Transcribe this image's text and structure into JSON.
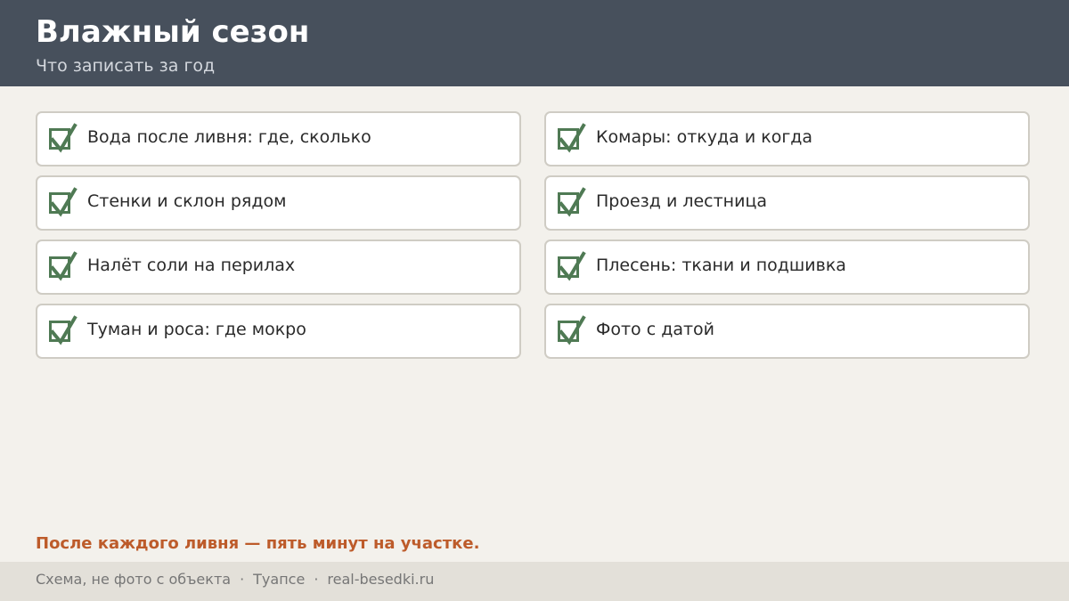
{
  "header": {
    "title": "Влажный сезон",
    "subtitle": "Что записать за год",
    "background_color": "#47505c"
  },
  "checklist": {
    "check_color": "#4f7a54",
    "items": [
      {
        "label": "Вода после ливня: где, сколько",
        "checked": true
      },
      {
        "label": "Комары: откуда и когда",
        "checked": true
      },
      {
        "label": "Стенки и склон рядом",
        "checked": true
      },
      {
        "label": "Проезд и лестница",
        "checked": true
      },
      {
        "label": "Налёт соли на перилах",
        "checked": true
      },
      {
        "label": "Плесень: ткани и подшивка",
        "checked": true
      },
      {
        "label": "Туман и роса: где мокро",
        "checked": true
      },
      {
        "label": "Фото с датой",
        "checked": true
      }
    ]
  },
  "note": {
    "text": "После каждого ливня — пять минут на участке.",
    "color": "#bd5b2a"
  },
  "footer": {
    "caption": "Схема, не фото с объекта",
    "separator": "·",
    "location": "Туапсе",
    "site": "real-besedki.ru"
  }
}
